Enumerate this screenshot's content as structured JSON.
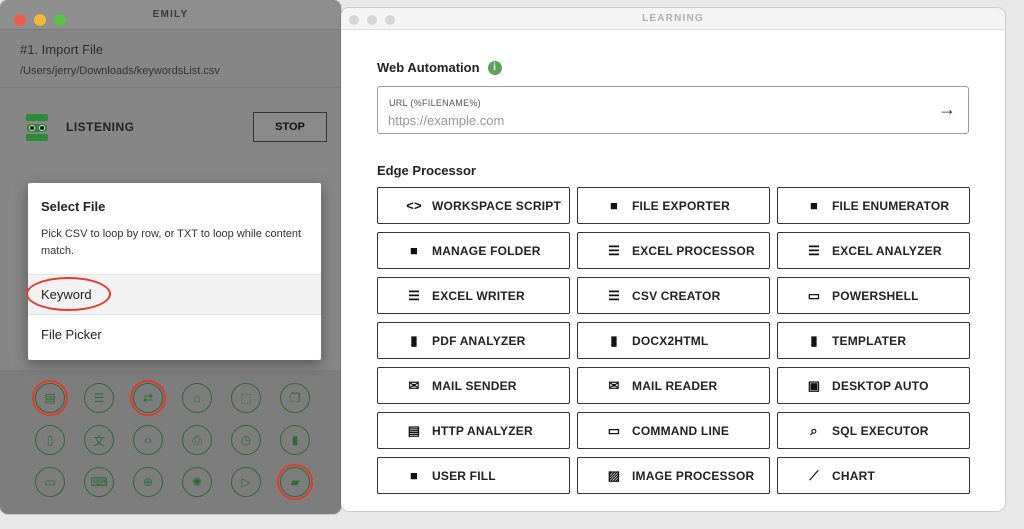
{
  "emily": {
    "title": "EMILY",
    "import_title": "#1. Import File",
    "import_path": "/Users/jerry/Downloads/keywordsList.csv",
    "status": "LISTENING",
    "stop_label": "STOP",
    "popup": {
      "title": "Select File",
      "description": "Pick CSV to loop by row, or TXT to loop while content match.",
      "options": [
        "Keyword",
        "File Picker"
      ]
    },
    "tools": [
      "file-icon",
      "list-icon",
      "repeat-icon",
      "home-icon",
      "select-icon",
      "copy-icon",
      "clipboard-icon",
      "translate-icon",
      "code-icon",
      "print-icon",
      "alarm-icon",
      "document-icon",
      "archive-icon",
      "keyboard-icon",
      "target-icon",
      "lightbulb-icon",
      "play-file-icon",
      "folder-open-icon"
    ]
  },
  "learning": {
    "title": "LEARNING",
    "web_heading": "Web Automation",
    "url_label": "URL (%FILENAME%)",
    "url_placeholder": "https://example.com",
    "edge_heading": "Edge Processor",
    "processors": [
      {
        "label": "WORKSPACE SCRIPT",
        "icon": "code-icon",
        "glyph": "<>"
      },
      {
        "label": "FILE EXPORTER",
        "icon": "folder-icon",
        "glyph": "■"
      },
      {
        "label": "FILE ENUMERATOR",
        "icon": "folder-icon",
        "glyph": "■"
      },
      {
        "label": "MANAGE FOLDER",
        "icon": "folder-icon",
        "glyph": "■"
      },
      {
        "label": "EXCEL PROCESSOR",
        "icon": "list-icon",
        "glyph": "☰"
      },
      {
        "label": "EXCEL ANALYZER",
        "icon": "list-icon",
        "glyph": "☰"
      },
      {
        "label": "EXCEL WRITER",
        "icon": "list-icon",
        "glyph": "☰"
      },
      {
        "label": "CSV CREATOR",
        "icon": "list-icon",
        "glyph": "☰"
      },
      {
        "label": "POWERSHELL",
        "icon": "laptop-icon",
        "glyph": "▭"
      },
      {
        "label": "PDF ANALYZER",
        "icon": "document-icon",
        "glyph": "▮"
      },
      {
        "label": "DOCX2HTML",
        "icon": "document-icon",
        "glyph": "▮"
      },
      {
        "label": "TEMPLATER",
        "icon": "document-icon",
        "glyph": "▮"
      },
      {
        "label": "MAIL SENDER",
        "icon": "mail-icon",
        "glyph": "✉"
      },
      {
        "label": "MAIL READER",
        "icon": "mail-icon",
        "glyph": "✉"
      },
      {
        "label": "DESKTOP AUTO",
        "icon": "desktop-icon",
        "glyph": "▣"
      },
      {
        "label": "HTTP ANALYZER",
        "icon": "browser-icon",
        "glyph": "▤"
      },
      {
        "label": "COMMAND LINE",
        "icon": "laptop-icon",
        "glyph": "▭"
      },
      {
        "label": "SQL EXECUTOR",
        "icon": "search-icon",
        "glyph": "⌕"
      },
      {
        "label": "USER FILL",
        "icon": "folder-info-icon",
        "glyph": "■"
      },
      {
        "label": "IMAGE PROCESSOR",
        "icon": "image-icon",
        "glyph": "▨"
      },
      {
        "label": "CHART",
        "icon": "chart-icon",
        "glyph": "⟋"
      }
    ]
  },
  "colors": {
    "accent_green": "#2c8a3a",
    "highlight_red": "#e23b2e",
    "info_green": "#5aa45a"
  }
}
